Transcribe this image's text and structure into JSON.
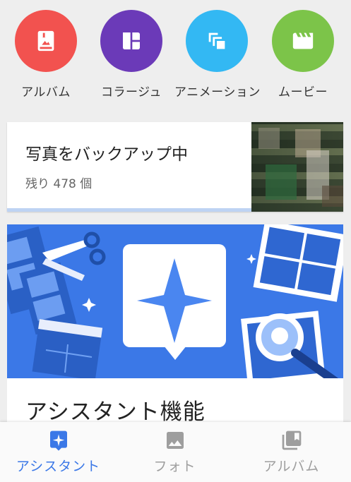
{
  "quick_actions": [
    {
      "label": "アルバム",
      "icon": "album-icon",
      "color": "#f2524f"
    },
    {
      "label": "コラージュ",
      "icon": "collage-icon",
      "color": "#6b3ab8"
    },
    {
      "label": "アニメーション",
      "icon": "animation-icon",
      "color": "#33b8f3"
    },
    {
      "label": "ムービー",
      "icon": "movie-icon",
      "color": "#7cc449"
    }
  ],
  "backup": {
    "title": "写真をバックアップ中",
    "remaining": "残り 478 個",
    "progress_color": "#bed3f3"
  },
  "assistant_card": {
    "title": "アシスタント機能",
    "hero_color": "#3b78e7"
  },
  "bottom_nav": [
    {
      "label": "アシスタント",
      "icon": "assistant-icon",
      "active": true
    },
    {
      "label": "フォト",
      "icon": "photo-icon",
      "active": false
    },
    {
      "label": "アルバム",
      "icon": "album-library-icon",
      "active": false
    }
  ],
  "colors": {
    "active": "#3b78e7",
    "inactive": "#9e9e9e"
  }
}
